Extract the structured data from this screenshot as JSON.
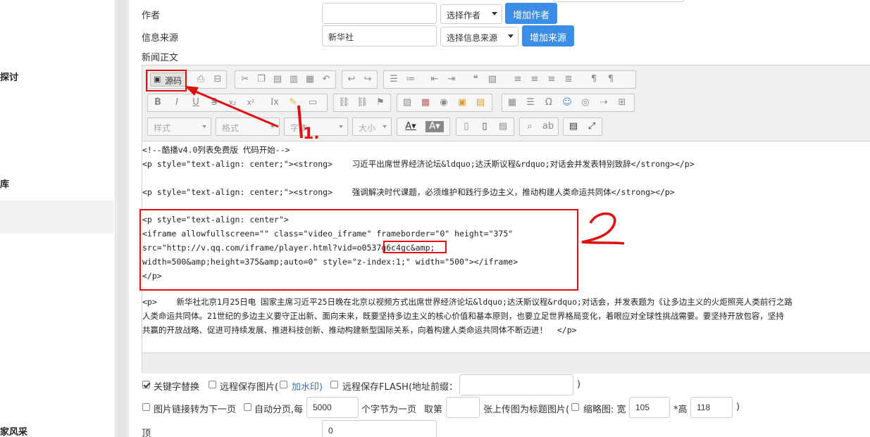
{
  "sidebar": {
    "items": [
      "探讨",
      "库",
      "家风采"
    ]
  },
  "form": {
    "author_label": "作者",
    "author_value": "",
    "author_select": "选择作者",
    "author_add": "增加作者",
    "source_label": "信息来源",
    "source_value": "新华社",
    "source_select": "选择信息来源",
    "source_add": "增加来源",
    "body_label": "新闻正文"
  },
  "toolbar": {
    "source_button": "源码",
    "style_combo": "样式",
    "format_combo": "格式",
    "font_combo": "字体",
    "size_combo": "大小"
  },
  "source_lines": [
    "<!--酷播v4.0列表免费版 代码开始-->",
    "<p style=\"text-align: center;\"><strong>    习近平出席世界经济论坛&ldquo;达沃斯议程&rdquo;对话会并发表特别致辞</strong></p>",
    "",
    "<p style=\"text-align: center;\"><strong>    强调解决时代课题，必须维护和践行多边主义，推动构建人类命运共同体</strong></p>",
    "",
    "<p style=\"text-align: center\">",
    "<iframe allowfullscreen=\"\" class=\"video_iframe\" frameborder=\"0\" height=\"375\"",
    "src=\"http://v.qq.com/iframe/player.html?vid=o0537g6c4gc&amp;",
    "width=500&amp;height=375&amp;auto=0\" style=\"z-index:1;\" width=\"500\"></iframe>",
    "</p>",
    "",
    "<p>    新华社北京1月25日电 国家主席习近平25日晚在北京以视频方式出席世界经济论坛&ldquo;达沃斯议程&rdquo;对话会，并发表题为《让多边主义的火炬照亮人类前行之路",
    "人类命运共同体。21世纪的多边主义要守正出新、面向未来，既要坚持多边主义的核心价值和基本原则，也要立足世界格局变化，着眼应对全球性挑战需要。要坚持开放包容，坚持",
    "共赢的开放战略、促进可持续发展、推进科技创新、推动构建新型国际关系，向着构建人类命运共同体不断迈进！  </p>"
  ],
  "options": {
    "keyword_replace": "关键字替换",
    "remote_save_images": "远程保存图片(",
    "add_watermark": "加水印)",
    "remote_save_flash": "远程保存FLASH(地址前缀：",
    "flash_prefix_value": "",
    "flash_close": ")",
    "link_next_page": "图片链接转为下一页",
    "auto_paging": "自动分页,每",
    "chars_per_page": "5000",
    "chars_label": "个字节为一页",
    "take_label": "取第",
    "take_value": "",
    "thumb_label": "张上传图为标题图片(",
    "thumbnail": "缩略图: 宽",
    "thumb_width": "105",
    "thumb_height_label": "*高",
    "thumb_height": "118",
    "thumb_close": ")",
    "top_label": "顶",
    "top_value": "0"
  },
  "annotations": {
    "label_one": "1.",
    "label_two": "2"
  },
  "colors": {
    "accent_blue": "#3a8ee6",
    "annotation_red": "#e01010"
  }
}
